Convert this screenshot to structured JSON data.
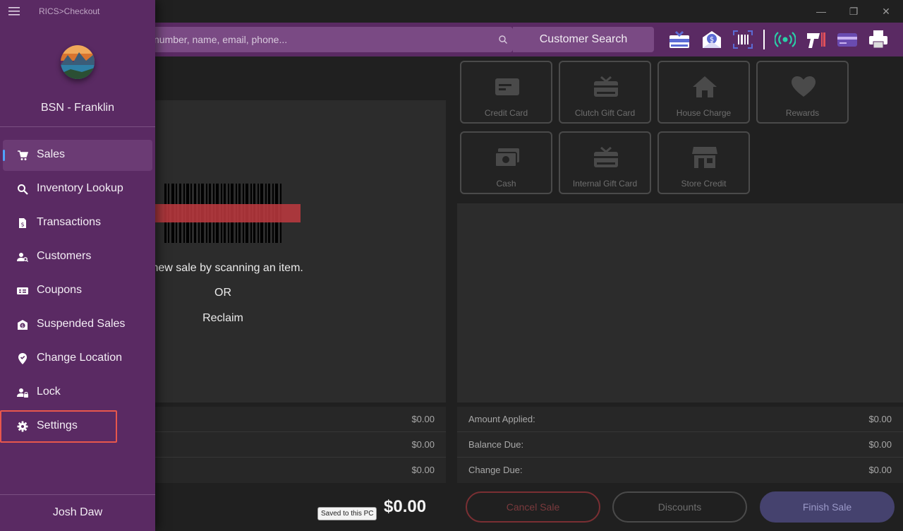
{
  "app": {
    "title": "RICS>Checkout"
  },
  "store": {
    "name": "BSN - Franklin"
  },
  "user": {
    "name": "Josh Daw"
  },
  "search": {
    "placeholder": "number, name, email, phone...",
    "button_label": "Customer Search"
  },
  "nav": {
    "items": [
      {
        "label": "Sales",
        "icon": "cart-icon",
        "active": true
      },
      {
        "label": "Inventory Lookup",
        "icon": "search-icon"
      },
      {
        "label": "Transactions",
        "icon": "receipt-icon"
      },
      {
        "label": "Customers",
        "icon": "customer-icon"
      },
      {
        "label": "Coupons",
        "icon": "coupon-icon"
      },
      {
        "label": "Suspended Sales",
        "icon": "suspended-icon"
      },
      {
        "label": "Change Location",
        "icon": "location-pin-icon"
      },
      {
        "label": "Lock",
        "icon": "lock-user-icon"
      },
      {
        "label": "Settings",
        "icon": "gear-icon"
      }
    ]
  },
  "scan": {
    "line1": "a new sale by scanning an item.",
    "line2": "OR",
    "line3": "Reclaim"
  },
  "totals_left": [
    "$0.00",
    "$0.00",
    "$0.00"
  ],
  "grand_total": "$0.00",
  "saved_badge": "Saved to this PC",
  "tenders": [
    {
      "label": "Credit Card",
      "icon": "credit-card-icon"
    },
    {
      "label": "Clutch Gift Card",
      "icon": "gift-card-icon"
    },
    {
      "label": "House Charge",
      "icon": "house-icon"
    },
    {
      "label": "Rewards",
      "icon": "heart-icon"
    },
    {
      "label": "Cash",
      "icon": "cash-icon"
    },
    {
      "label": "Internal Gift Card",
      "icon": "gift-card-icon"
    },
    {
      "label": "Store Credit",
      "icon": "store-icon"
    }
  ],
  "totals_right": [
    {
      "label": "Amount Applied:",
      "value": "$0.00"
    },
    {
      "label": "Balance Due:",
      "value": "$0.00"
    },
    {
      "label": "Change Due:",
      "value": "$0.00"
    }
  ],
  "actions": {
    "cancel": "Cancel Sale",
    "discounts": "Discounts",
    "finish": "Finish Sale"
  },
  "colors": {
    "drawer": "#5a2a63",
    "accent": "#4fa3ff",
    "highlight": "#e8574c"
  }
}
